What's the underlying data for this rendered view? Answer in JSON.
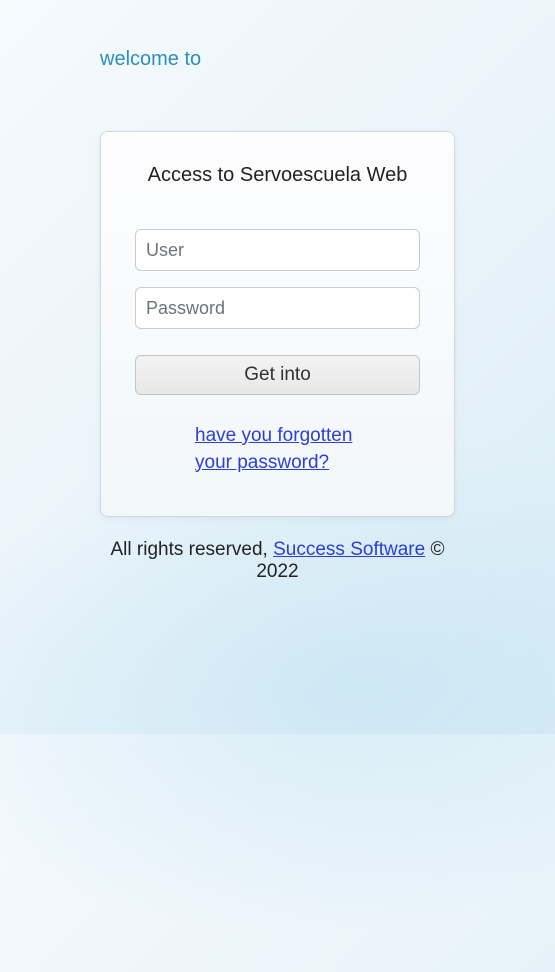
{
  "header": {
    "welcome": "welcome to"
  },
  "card": {
    "title": "Access to Servoescuela Web",
    "user_placeholder": "User",
    "password_placeholder": "Password",
    "login_button": "Get into",
    "forgot_password": "have you forgotten your password?"
  },
  "footer": {
    "rights_prefix": "All rights reserved, ",
    "company": "Success Software",
    "copyright_suffix": " © 2022"
  }
}
